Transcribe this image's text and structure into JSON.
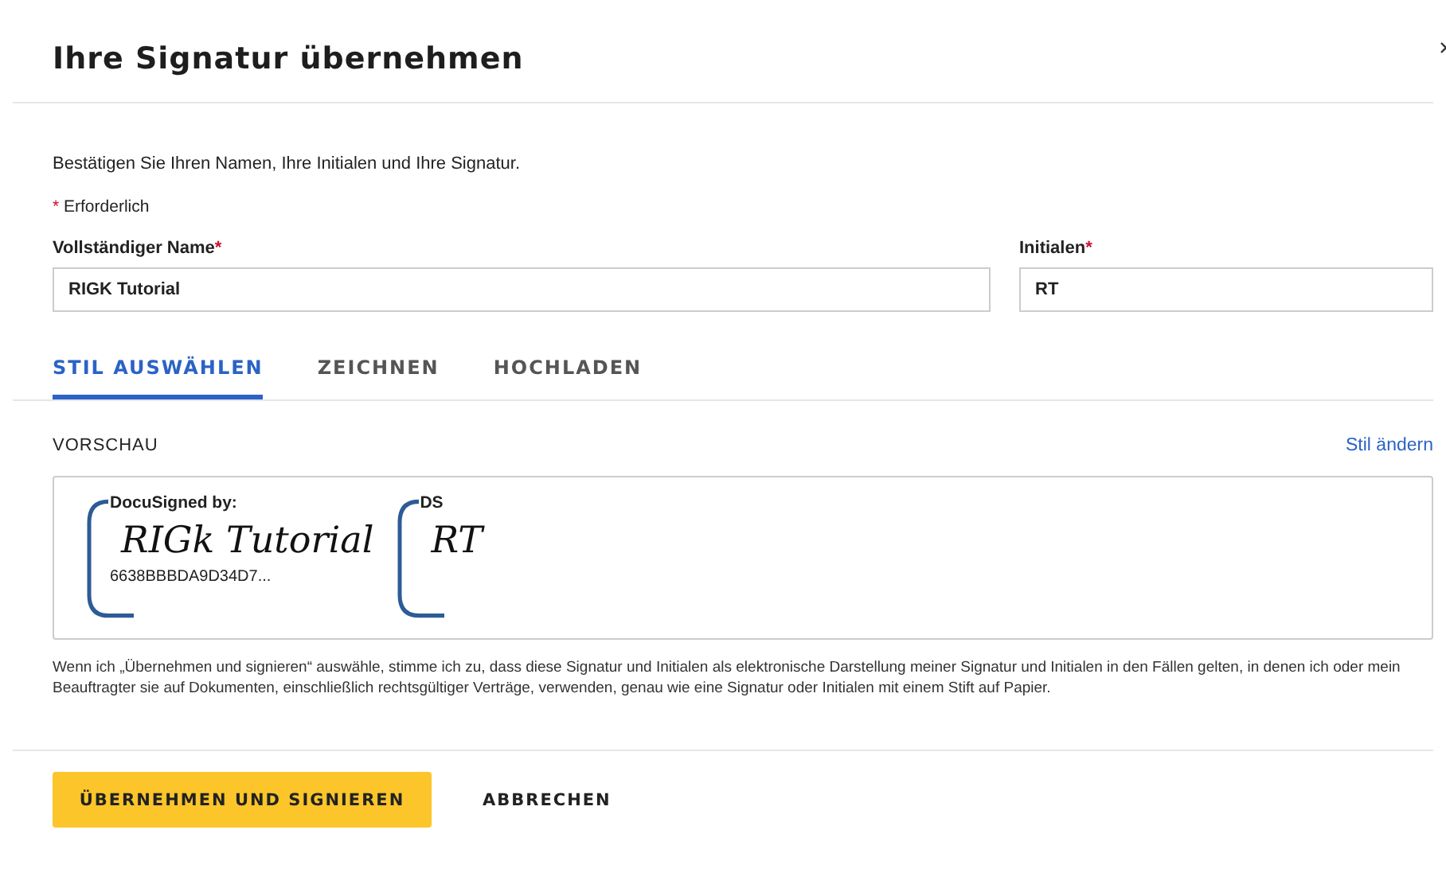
{
  "dialog": {
    "title": "Ihre Signatur übernehmen"
  },
  "intro": "Bestätigen Sie Ihren Namen, Ihre Initialen und Ihre Signatur.",
  "required_note": {
    "mark": "*",
    "text": "Erforderlich"
  },
  "fields": [
    {
      "label": "Vollständiger Name",
      "required_mark": "*",
      "value": "RIGK Tutorial"
    },
    {
      "label": "Initialen",
      "required_mark": "*",
      "value": "RT"
    }
  ],
  "tabs": [
    {
      "label": "STIL AUSWÄHLEN",
      "selected": true
    },
    {
      "label": "ZEICHNEN",
      "selected": false
    },
    {
      "label": "HOCHLADEN",
      "selected": false
    }
  ],
  "preview": {
    "heading": "VORSCHAU",
    "change_link": "Stil ändern",
    "signature": {
      "caption": "DocuSigned by:",
      "handwriting": "RIGk Tutorial",
      "id": "6638BBBDA9D34D7..."
    },
    "initials": {
      "caption": "DS",
      "handwriting": "RT"
    }
  },
  "disclaimer": "Wenn ich „Übernehmen und signieren“ auswähle, stimme ich zu, dass diese Signatur und Initialen als elektronische Darstellung meiner Signatur und Initialen in den Fällen gelten, in denen ich oder mein Beauftragter sie auf Dokumenten, einschließlich rechtsgültiger Verträge, verwenden, genau wie eine Signatur oder Initialen mit einem Stift auf Papier.",
  "buttons": [
    {
      "label": "ÜBERNEHMEN UND SIGNIEREN",
      "kind": "primary"
    },
    {
      "label": "ABBRECHEN",
      "kind": "secondary"
    }
  ]
}
